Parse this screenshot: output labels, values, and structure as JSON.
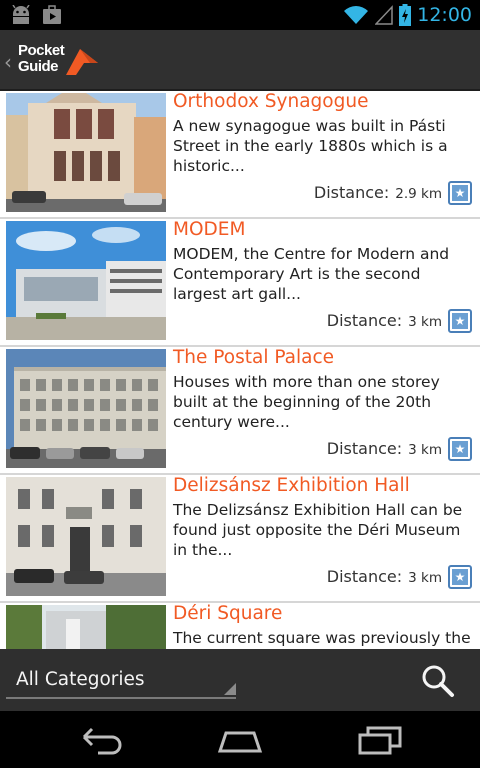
{
  "status_bar": {
    "time": "12:00",
    "icons": [
      "android-debug-icon",
      "play-store-icon",
      "wifi-icon",
      "signal-icon",
      "battery-charging-icon"
    ]
  },
  "app": {
    "logo_line1": "Pocket",
    "logo_line2": "Guide",
    "back_glyph": "‹"
  },
  "distance_label": "Distance:",
  "items": [
    {
      "title": "Orthodox Synagogue",
      "description": "A new synagogue was built in Pásti Street in the early 1880s which is a historic...",
      "distance": "2.9 km"
    },
    {
      "title": "MODEM",
      "description": "MODEM, the Centre for Modern and Contemporary Art is the second largest art gall...",
      "distance": "3 km"
    },
    {
      "title": "The Postal Palace",
      "description": "Houses with more than one storey built at the beginning of the 20th century were...",
      "distance": "3 km"
    },
    {
      "title": "Delizsánsz Exhibition Hall",
      "description": "The Delizsánsz Exhibition Hall can be found just opposite the Déri Museum in the...",
      "distance": "3 km"
    },
    {
      "title": "Déri Square",
      "description": "The current square was previously the",
      "distance": ""
    }
  ],
  "filter": {
    "category": "All Categories"
  },
  "colors": {
    "accent_orange": "#f15a24",
    "status_blue": "#33b5e5",
    "fav_blue": "#4a7fb8"
  }
}
